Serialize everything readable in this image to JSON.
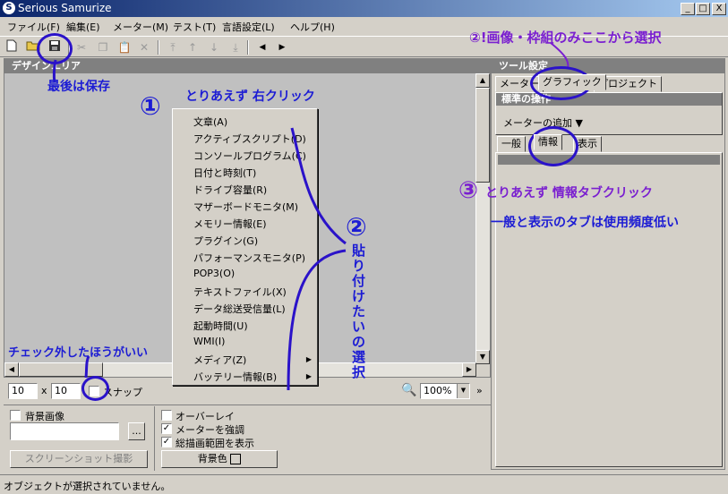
{
  "window": {
    "title": "Serious Samurize",
    "app_icon_glyph": "S",
    "minimize": "_",
    "maximize": "□",
    "close": "X"
  },
  "menu": [
    "ファイル(F)",
    "編集(E)",
    "メーター(M)",
    "テスト(T)",
    "言語設定(L)",
    "ヘルプ(H)"
  ],
  "toolbar": {
    "new": "new-file-icon",
    "open": "open-folder-icon",
    "save": "save-disk-icon",
    "cut": "cut-icon",
    "copy": "copy-icon",
    "paste": "paste-icon",
    "delete": "delete-icon",
    "arrows": [
      "⤒",
      "↑",
      "↓",
      "⤓"
    ],
    "prev": "◀",
    "next": "▶"
  },
  "design_panel": {
    "header": "デザインエリア"
  },
  "context_menu": [
    {
      "label": "文章(A)",
      "submenu": false
    },
    {
      "label": "アクティブスクリプト(D)",
      "submenu": false
    },
    {
      "label": "コンソールプログラム(C)",
      "submenu": false
    },
    {
      "label": "日付と時刻(T)",
      "submenu": false
    },
    {
      "label": "ドライブ容量(R)",
      "submenu": false
    },
    {
      "label": "マザーボードモニタ(M)",
      "submenu": false
    },
    {
      "label": "メモリー情報(E)",
      "submenu": false
    },
    {
      "label": "プラグイン(G)",
      "submenu": false
    },
    {
      "label": "パフォーマンスモニタ(P)",
      "submenu": false
    },
    {
      "label": "POP3(O)",
      "submenu": false
    },
    {
      "label": "テキストファイル(X)",
      "submenu": false
    },
    {
      "label": "データ総送受信量(L)",
      "submenu": false
    },
    {
      "label": "起動時間(U)",
      "submenu": false
    },
    {
      "label": "WMI(I)",
      "submenu": false
    },
    {
      "label": "メディア(Z)",
      "submenu": true
    },
    {
      "label": "バッテリー情報(B)",
      "submenu": true
    }
  ],
  "grid": {
    "x": "10",
    "times": "x",
    "y": "10",
    "snap_label": "スナップ",
    "snap_checked": false
  },
  "zoom": {
    "value": "100%",
    "icon": "zoom-page-icon",
    "more": "»"
  },
  "bottom": {
    "background_image_label": "背景画像",
    "background_image_checked": false,
    "browse": "...",
    "screenshot_button": "スクリーンショット撮影",
    "overlay_label": "オーバーレイ",
    "overlay_checked": false,
    "highlight_meter_label": "メーターを強調",
    "highlight_meter_checked": true,
    "show_draw_range_label": "総描画範囲を表示",
    "show_draw_range_checked": true,
    "bg_color_label": "背景色"
  },
  "tool_panel": {
    "header": "ツール設定",
    "tabs": [
      "メーター",
      "グラフィック",
      "プロジェクト"
    ],
    "standard_ops": "標準の操作",
    "add_meter": "メーターの追加 ▼",
    "sub_tabs": [
      "一般",
      "情報",
      "表示"
    ]
  },
  "status": "オブジェクトが選択されていません。",
  "annotations": {
    "save_note": "最後は保存",
    "step1_num": "①",
    "step1_text": "とりあえず 右クリック",
    "step2_num": "②",
    "step2_text": [
      "貼",
      "り",
      "付",
      "け",
      "た",
      "い",
      "の",
      "選",
      "択"
    ],
    "step2b": "②!画像・枠組のみここから選択",
    "step3_num": "③",
    "step3_text": "とりあえず 情報タブクリック",
    "low_usage": "一般と表示のタブは使用頻度低い",
    "snap_note": "チェック外したほうがいい"
  },
  "colors": {
    "annotation_blue": "#1c1cd4",
    "annotation_purple": "#7a1fd0",
    "title_bar": "#0a246a",
    "selection": "#808080"
  }
}
